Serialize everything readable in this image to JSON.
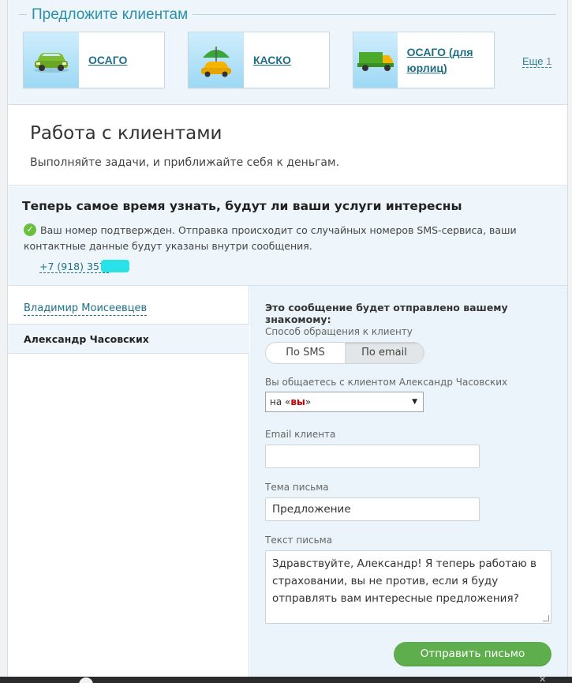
{
  "offers": {
    "title": "Предложите клиентам",
    "items": [
      {
        "label": "ОСАГО",
        "icon": "car-icon"
      },
      {
        "label": "КАСКО",
        "icon": "umbrella-car-icon"
      },
      {
        "label": "ОСАГО (для юрлиц)",
        "icon": "truck-icon"
      }
    ],
    "more_label": "Еще",
    "more_count": "1"
  },
  "work": {
    "title": "Работа с клиентами",
    "subtitle": "Выполняйте задачи, и приближайте себя к деньгам."
  },
  "notice": {
    "heading": "Теперь самое время узнать, будут ли ваши услуги интересны",
    "message": "Ваш номер подтвержден. Отправка происходит со случайных номеров SMS-сервиса, ваши контактные данные будут указаны внутри сообщения.",
    "phone": "+7 (918) 357-"
  },
  "clients": [
    {
      "name": "Владимир Моисеевцев"
    },
    {
      "name": "Александр Часовских"
    }
  ],
  "form": {
    "heading": "Это сообщение будет отправлено вашему знакомому:",
    "contact_method_label": "Способ обращения к клиенту",
    "contact_methods": [
      "По SMS",
      "По email"
    ],
    "active_method": "По email",
    "address_label": "Вы общаетесь с клиентом Александр Часовских",
    "address_prefix": "на «",
    "address_value": "вы",
    "address_suffix": "»",
    "email_label": "Email клиента",
    "email_value": "",
    "subject_label": "Тема письма",
    "subject_value": "Предложение",
    "body_label": "Текст письма",
    "body_value": "Здравствуйте, Александр! Я теперь работаю в страховании, вы не против, если я буду отправлять вам интересные предложения?",
    "submit_label": "Отправить письмо"
  },
  "colors": {
    "accent": "#2a8fa8",
    "link": "#1f6f86",
    "submit": "#5fae4e",
    "panel": "#eaf4fa"
  }
}
